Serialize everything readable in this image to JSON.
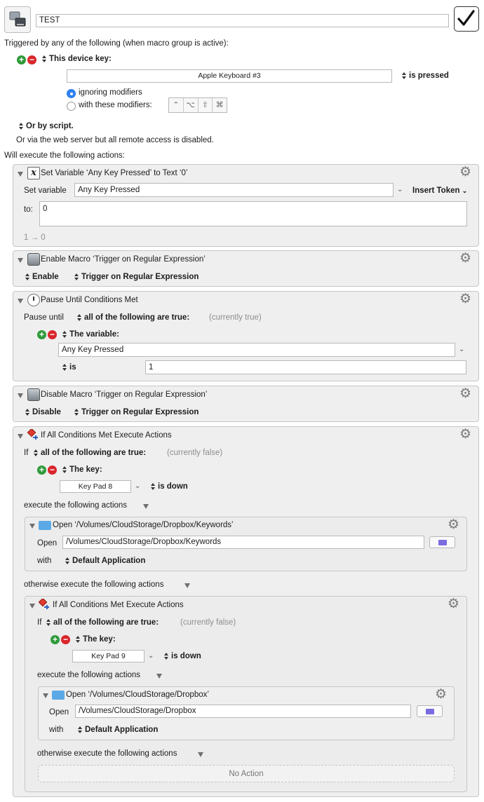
{
  "header": {
    "macro_name": "TEST",
    "enabled": true
  },
  "trigger": {
    "intro": "Triggered by any of the following (when macro group is active):",
    "type_label": "This device key:",
    "device_key": "Apple Keyboard #3",
    "condition": "is pressed",
    "modifier_option_1": "ignoring modifiers",
    "modifier_option_2": "with these modifiers:",
    "modifier_keys": [
      "⌃",
      "⌥",
      "⇧",
      "⌘"
    ],
    "or_script": "Or by script.",
    "web_server_note": "Or via the web server but all remote access is disabled."
  },
  "actions_intro": "Will execute the following actions:",
  "action1": {
    "title": "Set Variable ‘Any Key Pressed’ to Text ‘0’",
    "set_label": "Set variable",
    "variable": "Any Key Pressed",
    "insert_token": "Insert Token",
    "to_label": "to:",
    "text_value": "0",
    "result": "1 → 0"
  },
  "action2": {
    "title": "Enable Macro ‘Trigger on Regular Expression’",
    "mode": "Enable",
    "macro": "Trigger on Regular Expression"
  },
  "action3": {
    "title": "Pause Until Conditions Met",
    "pause_label": "Pause until",
    "scope": "all of the following are true:",
    "status": "(currently true)",
    "condition_type": "The variable:",
    "variable": "Any Key Pressed",
    "operator": "is",
    "value": "1"
  },
  "action4": {
    "title": "Disable Macro ‘Trigger on Regular Expression’",
    "mode": "Disable",
    "macro": "Trigger on Regular Expression"
  },
  "action5": {
    "title": "If All Conditions Met Execute Actions",
    "if_label": "If",
    "scope": "all of the following are true:",
    "status": "(currently false)",
    "condition_type": "The key:",
    "key": "Key Pad 8",
    "key_state": "is down",
    "execute_label": "execute the following actions",
    "open_action": {
      "title": "Open ‘/Volumes/CloudStorage/Dropbox/Keywords’",
      "open_label": "Open",
      "path": "/Volumes/CloudStorage/Dropbox/Keywords",
      "with_label": "with",
      "app": "Default Application"
    },
    "otherwise_label": "otherwise execute the following actions",
    "nested_if": {
      "title": "If All Conditions Met Execute Actions",
      "if_label": "If",
      "scope": "all of the following are true:",
      "status": "(currently false)",
      "condition_type": "The key:",
      "key": "Key Pad 9",
      "key_state": "is down",
      "execute_label": "execute the following actions",
      "open_action": {
        "title": "Open ‘/Volumes/CloudStorage/Dropbox’",
        "open_label": "Open",
        "path": "/Volumes/CloudStorage/Dropbox",
        "with_label": "with",
        "app": "Default Application"
      },
      "otherwise_label": "otherwise execute the following actions",
      "no_action": "No Action"
    }
  }
}
